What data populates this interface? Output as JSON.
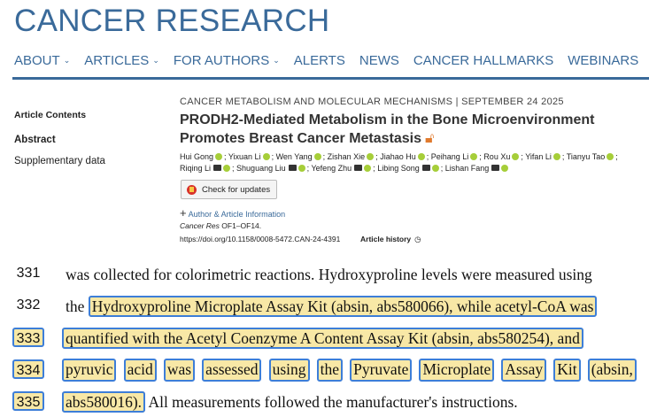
{
  "site": {
    "brand": "CANCER RESEARCH"
  },
  "nav": [
    {
      "label": "ABOUT",
      "chevron": true
    },
    {
      "label": "ARTICLES",
      "chevron": true
    },
    {
      "label": "FOR AUTHORS",
      "chevron": true
    },
    {
      "label": "ALERTS",
      "chevron": false
    },
    {
      "label": "NEWS",
      "chevron": false
    },
    {
      "label": "CANCER HALLMARKS",
      "chevron": false
    },
    {
      "label": "WEBINARS",
      "chevron": false
    }
  ],
  "sidebar": {
    "contents": "Article Contents",
    "abstract": "Abstract",
    "supplementary": "Supplementary data"
  },
  "article": {
    "kicker": "CANCER METABOLISM AND MOLECULAR MECHANISMS |  SEPTEMBER 24 2025",
    "title": "PRODH2-Mediated Metabolism in the Bone Microenvironment Promotes Breast Cancer Metastasis",
    "authors_line1": [
      "Hui Gong",
      "Yixuan Li",
      "Wen Yang",
      "Zishan Xie",
      "Jiahao Hu",
      "Peihang Li",
      "Rou Xu",
      "Yifan Li",
      "Tianyu Tao"
    ],
    "authors_line2": [
      "Riqing Li",
      "Shuguang Liu",
      "Yefeng Zhu",
      "Libing Song",
      "Lishan Fang"
    ],
    "check_updates": "Check for updates",
    "author_info": "Author & Article Information",
    "journal": "Cancer Res",
    "pages": "OF1–OF14.",
    "doi": "https://doi.org/10.1158/0008-5472.CAN-24-4391",
    "history": "Article history"
  },
  "manuscript": {
    "lines": [
      {
        "num": "331",
        "text": "was collected for colorimetric reactions. Hydroxyproline levels were measured using"
      },
      {
        "num": "332",
        "pre": "the ",
        "hl": "Hydroxyproline Microplate Assay Kit (absin, abs580066), while acetyl-CoA was"
      },
      {
        "num": "333",
        "hl": "quantified with the Acetyl Coenzyme A Content Assay Kit (absin, abs580254), and"
      },
      {
        "num": "334",
        "words": [
          "pyruvic",
          "acid",
          "was",
          "assessed",
          "using",
          "the",
          "Pyruvate",
          "Microplate",
          "Assay",
          "Kit",
          "(absin,"
        ]
      },
      {
        "num": "335",
        "hl": "abs580016).",
        "post": " All measurements followed the manufacturer's instructions."
      }
    ]
  },
  "colors": {
    "accent": "#3a6a9a",
    "highlight": "#f8e8a6",
    "highlight_border": "#3d7ed8"
  }
}
